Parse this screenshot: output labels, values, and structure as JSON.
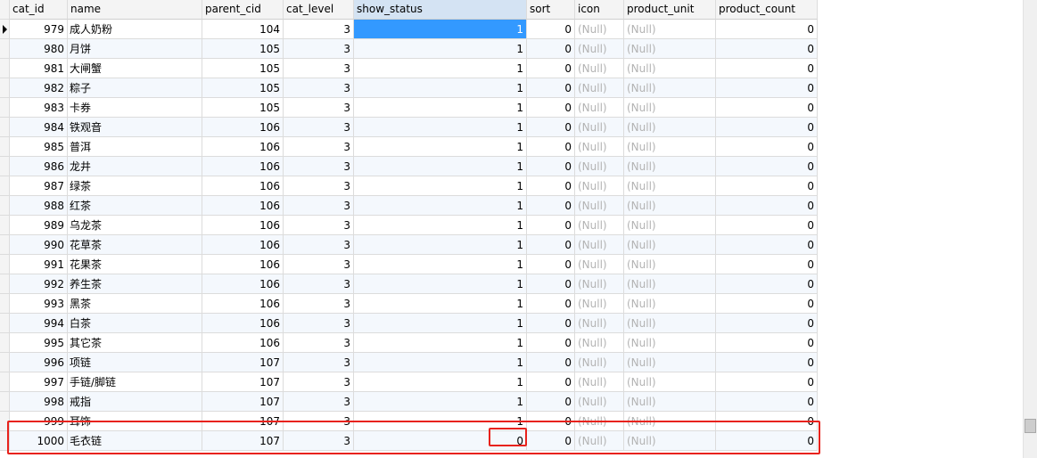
{
  "columns": [
    {
      "key": "cat_id",
      "label": "cat_id"
    },
    {
      "key": "name",
      "label": "name"
    },
    {
      "key": "parent_cid",
      "label": "parent_cid"
    },
    {
      "key": "cat_level",
      "label": "cat_level"
    },
    {
      "key": "show_status",
      "label": "show_status"
    },
    {
      "key": "sort",
      "label": "sort"
    },
    {
      "key": "icon",
      "label": "icon"
    },
    {
      "key": "product_unit",
      "label": "product_unit"
    },
    {
      "key": "product_count",
      "label": "product_count"
    }
  ],
  "null_text": "(Null)",
  "active_column": "show_status",
  "rows": [
    {
      "cat_id": "979",
      "name": "成人奶粉",
      "parent_cid": "104",
      "cat_level": "3",
      "show_status": "1",
      "sort": "0",
      "product_count": "0"
    },
    {
      "cat_id": "980",
      "name": "月饼",
      "parent_cid": "105",
      "cat_level": "3",
      "show_status": "1",
      "sort": "0",
      "product_count": "0"
    },
    {
      "cat_id": "981",
      "name": "大闸蟹",
      "parent_cid": "105",
      "cat_level": "3",
      "show_status": "1",
      "sort": "0",
      "product_count": "0"
    },
    {
      "cat_id": "982",
      "name": "粽子",
      "parent_cid": "105",
      "cat_level": "3",
      "show_status": "1",
      "sort": "0",
      "product_count": "0"
    },
    {
      "cat_id": "983",
      "name": "卡券",
      "parent_cid": "105",
      "cat_level": "3",
      "show_status": "1",
      "sort": "0",
      "product_count": "0"
    },
    {
      "cat_id": "984",
      "name": "铁观音",
      "parent_cid": "106",
      "cat_level": "3",
      "show_status": "1",
      "sort": "0",
      "product_count": "0"
    },
    {
      "cat_id": "985",
      "name": "普洱",
      "parent_cid": "106",
      "cat_level": "3",
      "show_status": "1",
      "sort": "0",
      "product_count": "0"
    },
    {
      "cat_id": "986",
      "name": "龙井",
      "parent_cid": "106",
      "cat_level": "3",
      "show_status": "1",
      "sort": "0",
      "product_count": "0"
    },
    {
      "cat_id": "987",
      "name": "绿茶",
      "parent_cid": "106",
      "cat_level": "3",
      "show_status": "1",
      "sort": "0",
      "product_count": "0"
    },
    {
      "cat_id": "988",
      "name": "红茶",
      "parent_cid": "106",
      "cat_level": "3",
      "show_status": "1",
      "sort": "0",
      "product_count": "0"
    },
    {
      "cat_id": "989",
      "name": "乌龙茶",
      "parent_cid": "106",
      "cat_level": "3",
      "show_status": "1",
      "sort": "0",
      "product_count": "0"
    },
    {
      "cat_id": "990",
      "name": "花草茶",
      "parent_cid": "106",
      "cat_level": "3",
      "show_status": "1",
      "sort": "0",
      "product_count": "0"
    },
    {
      "cat_id": "991",
      "name": "花果茶",
      "parent_cid": "106",
      "cat_level": "3",
      "show_status": "1",
      "sort": "0",
      "product_count": "0"
    },
    {
      "cat_id": "992",
      "name": "养生茶",
      "parent_cid": "106",
      "cat_level": "3",
      "show_status": "1",
      "sort": "0",
      "product_count": "0"
    },
    {
      "cat_id": "993",
      "name": "黑茶",
      "parent_cid": "106",
      "cat_level": "3",
      "show_status": "1",
      "sort": "0",
      "product_count": "0"
    },
    {
      "cat_id": "994",
      "name": "白茶",
      "parent_cid": "106",
      "cat_level": "3",
      "show_status": "1",
      "sort": "0",
      "product_count": "0"
    },
    {
      "cat_id": "995",
      "name": "其它茶",
      "parent_cid": "106",
      "cat_level": "3",
      "show_status": "1",
      "sort": "0",
      "product_count": "0"
    },
    {
      "cat_id": "996",
      "name": "项链",
      "parent_cid": "107",
      "cat_level": "3",
      "show_status": "1",
      "sort": "0",
      "product_count": "0"
    },
    {
      "cat_id": "997",
      "name": "手链/脚链",
      "parent_cid": "107",
      "cat_level": "3",
      "show_status": "1",
      "sort": "0",
      "product_count": "0"
    },
    {
      "cat_id": "998",
      "name": "戒指",
      "parent_cid": "107",
      "cat_level": "3",
      "show_status": "1",
      "sort": "0",
      "product_count": "0"
    },
    {
      "cat_id": "999",
      "name": "耳饰",
      "parent_cid": "107",
      "cat_level": "3",
      "show_status": "1",
      "sort": "0",
      "product_count": "0"
    },
    {
      "cat_id": "1000",
      "name": "毛衣链",
      "parent_cid": "107",
      "cat_level": "3",
      "show_status": "0",
      "sort": "0",
      "product_count": "0"
    }
  ],
  "selected_row_index": 0,
  "highlight_color": "#e8221b",
  "selection_color": "#3399ff"
}
